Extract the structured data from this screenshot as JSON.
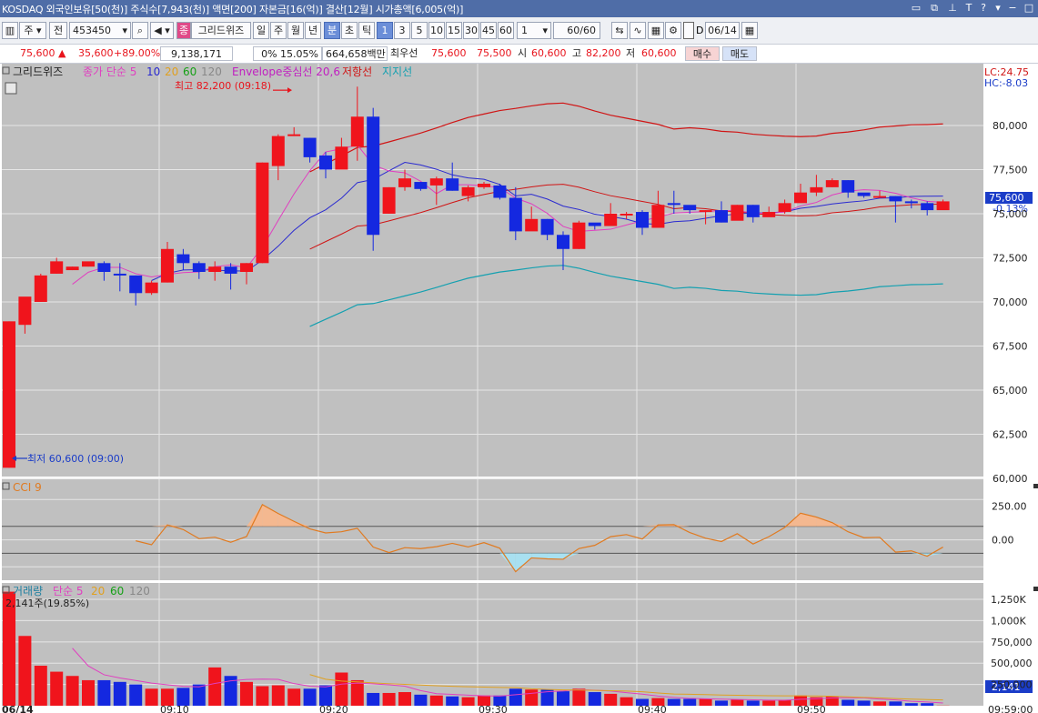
{
  "title_bar": {
    "text": "KOSDAQ 외국인보유[50(천)] 주식수[7,943(천)] 액면[200] 자본금[16(억)] 결산[12월] 시가총액[6,005(억)]"
  },
  "toolbar": {
    "market": "주",
    "all_label": "전",
    "code": "453450",
    "name_badge": "종",
    "stock_name": "그리드위즈",
    "period_day": "일",
    "period_week": "주",
    "period_month": "월",
    "period_year": "년",
    "period_minute": "분",
    "period_second": "초",
    "period_tick": "틱",
    "intervals": [
      "1",
      "3",
      "5",
      "10",
      "15",
      "30",
      "45",
      "60"
    ],
    "interval_value": "1",
    "count_value": "60",
    "count_total": "/60",
    "date_label": "D",
    "date_value": "06/14"
  },
  "quote": {
    "price": "75,600",
    "change": "35,600",
    "change_pct": "+89.00%",
    "volume": "9,138,171",
    "turnover_pct": "0% 15.05%",
    "amount": "664,658백만",
    "best_ask_label": "최우선",
    "best_ask": "75,600",
    "best_bid": "75,500",
    "open_label": "시",
    "open": "60,600",
    "high_label": "고",
    "high": "82,200",
    "low_label": "저",
    "low": "60,600",
    "buy_label": "매수",
    "sell_label": "매도"
  },
  "price_panel": {
    "legend_name": "그리드위즈",
    "legend_ma": "종가 단순 5",
    "legend_ma10": "10",
    "legend_ma20": "20",
    "legend_ma60": "60",
    "legend_ma120": "120",
    "legend_env": "Envelope중심선 20,6",
    "legend_resist": "저항선",
    "legend_support": "지지선",
    "lc": "LC:24.75",
    "hc": "HC:-8.03",
    "max_label": "최고 82,200 (09:18)",
    "min_label": "최저 60,600 (09:00)",
    "current_price": "75,600",
    "current_pct": "-0.13%",
    "axis": [
      "80,000",
      "77,500",
      "75,000",
      "72,500",
      "70,000",
      "67,500",
      "65,000",
      "62,500",
      "60,000"
    ]
  },
  "cci_panel": {
    "legend": "CCI 9",
    "axis": [
      "250.00",
      "0.00"
    ]
  },
  "volume_panel": {
    "legend_name": "거래량",
    "legend_ma": "단순 5",
    "legend_ma20": "20",
    "legend_ma60": "60",
    "legend_ma120": "120",
    "last_volume": "2,141주(19.85%)",
    "current": "2,141",
    "axis": [
      "1,250K",
      "1,000K",
      "750,000",
      "500,000",
      "250,000"
    ]
  },
  "time_axis": {
    "date_label": "06/14",
    "labels": [
      "09:10",
      "09:20",
      "09:30",
      "09:40",
      "09:50",
      "09:59:00"
    ]
  },
  "chart_data": {
    "type": "candlestick",
    "interval": "1분",
    "times": [
      "09:00",
      "09:01",
      "09:02",
      "09:03",
      "09:04",
      "09:05",
      "09:06",
      "09:07",
      "09:08",
      "09:09",
      "09:10",
      "09:11",
      "09:12",
      "09:13",
      "09:14",
      "09:15",
      "09:16",
      "09:17",
      "09:18",
      "09:19",
      "09:20",
      "09:21",
      "09:22",
      "09:23",
      "09:24",
      "09:25",
      "09:26",
      "09:27",
      "09:28",
      "09:29",
      "09:30",
      "09:31",
      "09:32",
      "09:33",
      "09:34",
      "09:35",
      "09:36",
      "09:37",
      "09:38",
      "09:39",
      "09:40",
      "09:41",
      "09:42",
      "09:43",
      "09:44",
      "09:45",
      "09:46",
      "09:47",
      "09:48",
      "09:49",
      "09:50",
      "09:51",
      "09:52",
      "09:53",
      "09:54",
      "09:55",
      "09:56",
      "09:57",
      "09:58",
      "09:59"
    ],
    "candles": [
      [
        60600,
        68900,
        60600,
        68900
      ],
      [
        68700,
        70300,
        68200,
        70000
      ],
      [
        70000,
        71500,
        70000,
        71600
      ],
      [
        71600,
        72300,
        71600,
        72500
      ],
      [
        71800,
        72000,
        71800,
        72000
      ],
      [
        72000,
        72300,
        72000,
        72100
      ],
      [
        72200,
        71700,
        71200,
        72300
      ],
      [
        71600,
        71500,
        70600,
        72200
      ],
      [
        71500,
        70500,
        69800,
        71500
      ],
      [
        70500,
        71100,
        70400,
        71200
      ],
      [
        71100,
        73000,
        71100,
        73400
      ],
      [
        72700,
        72200,
        71800,
        73000
      ],
      [
        72200,
        71700,
        71300,
        72300
      ],
      [
        71700,
        72000,
        71200,
        72300
      ],
      [
        72000,
        71600,
        70700,
        72200
      ],
      [
        71700,
        72200,
        71000,
        72200
      ],
      [
        72200,
        77900,
        72200,
        77900
      ],
      [
        77700,
        79400,
        76900,
        79500
      ],
      [
        79500,
        79500,
        79400,
        79900
      ],
      [
        79300,
        78200,
        77900,
        79300
      ],
      [
        78300,
        77500,
        77000,
        78500
      ],
      [
        77500,
        78800,
        77700,
        79300
      ],
      [
        78800,
        80500,
        78000,
        82200
      ],
      [
        80500,
        73800,
        72900,
        81000
      ],
      [
        75000,
        76500,
        75000,
        76500
      ],
      [
        76500,
        77000,
        76300,
        77500
      ],
      [
        76800,
        76400,
        76300,
        76800
      ],
      [
        76600,
        77000,
        75500,
        77100
      ],
      [
        77000,
        76300,
        76300,
        77900
      ],
      [
        76000,
        76500,
        75700,
        76600
      ],
      [
        76500,
        76700,
        76400,
        76800
      ],
      [
        76600,
        75900,
        75800,
        76700
      ],
      [
        75900,
        74000,
        73500,
        76500
      ],
      [
        74000,
        74700,
        74700,
        75400
      ],
      [
        74700,
        73800,
        73500,
        74700
      ],
      [
        73800,
        73000,
        71800,
        74000
      ],
      [
        73000,
        74500,
        73000,
        74600
      ],
      [
        74500,
        74300,
        74100,
        74400
      ],
      [
        74300,
        75000,
        74500,
        75600
      ],
      [
        75000,
        75000,
        74700,
        75100
      ],
      [
        75100,
        74200,
        73800,
        75200
      ],
      [
        74200,
        75500,
        74300,
        76300
      ],
      [
        75600,
        75500,
        75000,
        76300
      ],
      [
        75500,
        75200,
        75000,
        75300
      ],
      [
        75100,
        75200,
        74400,
        75200
      ],
      [
        75200,
        74500,
        74500,
        75700
      ],
      [
        74600,
        75500,
        74700,
        75500
      ],
      [
        75500,
        74800,
        74500,
        75500
      ],
      [
        74800,
        75100,
        75000,
        75400
      ],
      [
        75100,
        75600,
        75000,
        75800
      ],
      [
        75600,
        76200,
        75800,
        76700
      ],
      [
        76200,
        76500,
        76000,
        77200
      ],
      [
        76500,
        76900,
        76500,
        77000
      ],
      [
        76900,
        76200,
        75900,
        76900
      ],
      [
        76200,
        76000,
        75900,
        76100
      ],
      [
        76000,
        76000,
        76000,
        76300
      ],
      [
        76000,
        75700,
        74500,
        76000
      ],
      [
        75700,
        75600,
        75300,
        75800
      ],
      [
        75600,
        75200,
        74900,
        75700
      ],
      [
        75200,
        75700,
        75300,
        75800
      ]
    ],
    "candle_format": [
      "open",
      "close",
      "low",
      "high"
    ],
    "note_values_estimated": true,
    "volume_approx": [
      1340000,
      820000,
      470000,
      400000,
      350000,
      300000,
      300000,
      280000,
      250000,
      200000,
      200000,
      210000,
      250000,
      450000,
      350000,
      280000,
      230000,
      240000,
      200000,
      200000,
      240000,
      390000,
      300000,
      150000,
      150000,
      160000,
      130000,
      120000,
      110000,
      100000,
      120000,
      120000,
      200000,
      190000,
      190000,
      170000,
      200000,
      160000,
      140000,
      100000,
      80000,
      90000,
      80000,
      80000,
      80000,
      60000,
      70000,
      60000,
      60000,
      70000,
      120000,
      100000,
      110000,
      70000,
      60000,
      50000,
      50000,
      30000,
      30000,
      2141
    ],
    "y_axis_range": [
      60000,
      82500
    ],
    "cci_range": [
      -300,
      400
    ]
  }
}
